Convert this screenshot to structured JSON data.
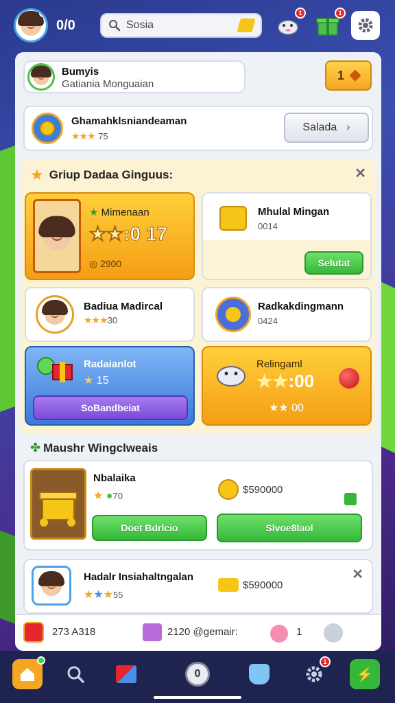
{
  "colors": {
    "accent": "#f5a623",
    "green": "#35b83a",
    "purple": "#7a4bd8",
    "blue": "#4a8fe8",
    "red": "#e6262d"
  },
  "topbar": {
    "level": "0/0",
    "search_placeholder": "Sosia",
    "gift_badge": "1",
    "present_badge": "1"
  },
  "profile": {
    "name": "Bumyis",
    "subtitle": "Gatiania Monguaian",
    "level_btn": "1"
  },
  "group_card": {
    "title": "Ghamahklsniandeaman",
    "rating": "75",
    "button": "Salada"
  },
  "section1": {
    "title": "Griup Dadaa Ginguus:"
  },
  "tiles": [
    {
      "title": "Mimenaan",
      "score": ":0 17",
      "coins": "2900"
    },
    {
      "title": "Mhulal Mingan",
      "sub": "0014",
      "button": "Selutat"
    },
    {
      "title": "Badiua Madircal",
      "rating": "30"
    },
    {
      "title": "Radkakdingmann",
      "sub": "0424"
    },
    {
      "title": "Radaianlot",
      "rating": "15",
      "button": "SoBandbeiat"
    },
    {
      "title": "Relingaml",
      "score": ":00",
      "rating": "00"
    }
  ],
  "section2": {
    "title": "Maushr Wingclweais"
  },
  "offer": {
    "title": "Nbalaika",
    "rating": "70",
    "price": "$590000",
    "btn_left": "Doet Bdrlcio",
    "btn_right": "Slvoe8laol"
  },
  "friend": {
    "title": "Hadalr Insiahaltngalan",
    "rating": "55",
    "price": "$590000"
  },
  "footer_bar": {
    "stat1": "273 A318",
    "stat2": "2120 @gemair:",
    "count": "1"
  },
  "nav": {
    "home_badge": "",
    "settings_badge": "1",
    "center_label": "0"
  }
}
